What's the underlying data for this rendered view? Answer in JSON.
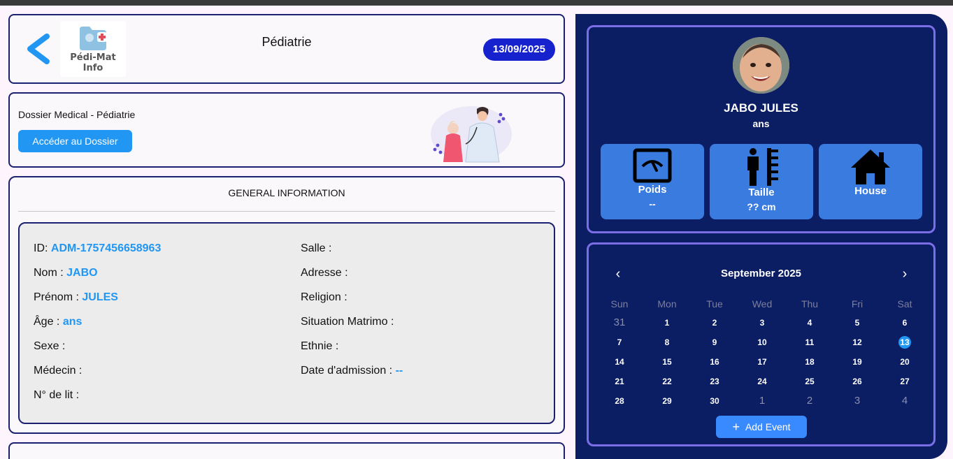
{
  "header": {
    "logo_line1": "Pédi-Mat",
    "logo_line2": "Info",
    "title": "Pédiatrie",
    "date": "13/09/2025"
  },
  "dossier": {
    "label": "Dossier Medical - Pédiatrie",
    "button": "Accéder au Dossier"
  },
  "general": {
    "title": "GENERAL INFORMATION",
    "left": [
      {
        "label": "ID:",
        "value": "ADM-1757456658963"
      },
      {
        "label": "Nom :",
        "value": "JABO"
      },
      {
        "label": "Prénom :",
        "value": "JULES"
      },
      {
        "label": "Âge :",
        "value": "ans"
      },
      {
        "label": "Sexe :",
        "value": ""
      },
      {
        "label": "Médecin :",
        "value": ""
      },
      {
        "label": "N° de lit :",
        "value": ""
      }
    ],
    "right": [
      {
        "label": "Salle :",
        "value": ""
      },
      {
        "label": "Adresse :",
        "value": ""
      },
      {
        "label": "Religion :",
        "value": ""
      },
      {
        "label": "Situation Matrimo :",
        "value": ""
      },
      {
        "label": "Ethnie :",
        "value": ""
      },
      {
        "label": "Date d'admission :",
        "value": "--"
      }
    ]
  },
  "patient": {
    "name": "JABO JULES",
    "age": "ans",
    "tiles": [
      {
        "label": "Poids",
        "value": "--",
        "icon": "scale-icon"
      },
      {
        "label": "Taille",
        "value": "?? cm",
        "icon": "height-icon"
      },
      {
        "label": "House",
        "value": "",
        "icon": "house-icon"
      }
    ]
  },
  "calendar": {
    "month": "September 2025",
    "weekdays": [
      "Sun",
      "Mon",
      "Tue",
      "Wed",
      "Thu",
      "Fri",
      "Sat"
    ],
    "weeks": [
      [
        "31",
        "1",
        "2",
        "3",
        "4",
        "5",
        "6"
      ],
      [
        "7",
        "8",
        "9",
        "10",
        "11",
        "12",
        "13"
      ],
      [
        "14",
        "15",
        "16",
        "17",
        "18",
        "19",
        "20"
      ],
      [
        "21",
        "22",
        "23",
        "24",
        "25",
        "26",
        "27"
      ],
      [
        "28",
        "29",
        "30",
        "1",
        "2",
        "3",
        "4"
      ]
    ],
    "muted": [
      [
        0,
        0
      ],
      [
        4,
        3
      ],
      [
        4,
        4
      ],
      [
        4,
        5
      ],
      [
        4,
        6
      ]
    ],
    "today": [
      1,
      6
    ],
    "add_event": "Add Event"
  },
  "colors": {
    "accent": "#2196f3",
    "panel": "#0b1d63",
    "date_pill": "#1722cf",
    "tile": "#3a7be0"
  }
}
